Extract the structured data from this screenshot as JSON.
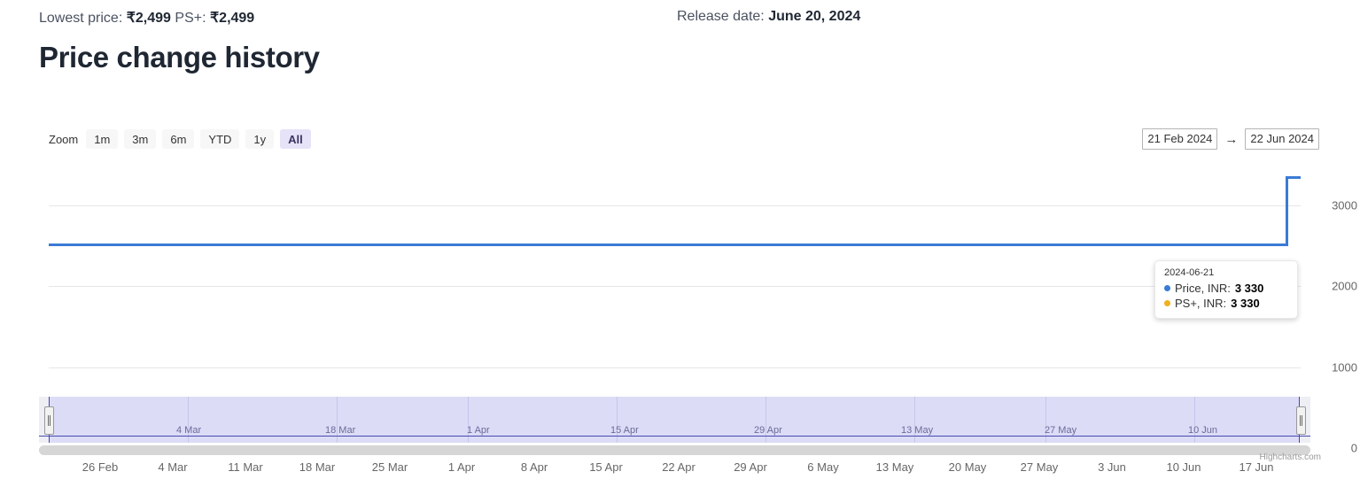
{
  "meta": {
    "lowest_price_label": "Lowest price:",
    "lowest_price_value": "₹2,499",
    "psplus_label": "PS+:",
    "psplus_value": "₹2,499",
    "release_label": "Release date:",
    "release_value": "June 20, 2024"
  },
  "page_title": "Price change history",
  "range_selector": {
    "zoom_label": "Zoom",
    "buttons": [
      {
        "label": "1m",
        "selected": false
      },
      {
        "label": "3m",
        "selected": false
      },
      {
        "label": "6m",
        "selected": false
      },
      {
        "label": "YTD",
        "selected": false
      },
      {
        "label": "1y",
        "selected": false
      },
      {
        "label": "All",
        "selected": true
      }
    ],
    "from_value": "21 Feb 2024",
    "separator": "→",
    "to_value": "22 Jun 2024"
  },
  "tooltip": {
    "date": "2024-06-21",
    "rows": [
      {
        "name": "Price, INR:",
        "value": "3 330",
        "color": "#3a7bd5"
      },
      {
        "name": "PS+, INR:",
        "value": "3 330",
        "color": "#f2b01e"
      }
    ]
  },
  "credits": "Highcharts.com",
  "colors": {
    "price_series": "#3a7bd5",
    "psplus_series": "#f2b01e",
    "selected_range_button": "#e6e2f8",
    "navigator_mask": "#dcdcf7",
    "navigator_outline": "#4444bb"
  },
  "navigator": {
    "tick_labels": [
      "4 Mar",
      "18 Mar",
      "1 Apr",
      "15 Apr",
      "29 Apr",
      "13 May",
      "27 May",
      "10 Jun"
    ],
    "selection_start_pct": 0.8,
    "selection_end_pct": 99.3
  },
  "chart_data": {
    "type": "line",
    "title": "Price change history",
    "xlabel": "",
    "ylabel": "",
    "ylim": [
      0,
      3500
    ],
    "grid": true,
    "legend_position": "none",
    "y_ticks": [
      "3000",
      "2000",
      "1000",
      "0"
    ],
    "y_tick_values": [
      3000,
      2000,
      1000,
      0
    ],
    "x_tick_labels": [
      "26 Feb",
      "4 Mar",
      "11 Mar",
      "18 Mar",
      "25 Mar",
      "1 Apr",
      "8 Apr",
      "15 Apr",
      "22 Apr",
      "29 Apr",
      "6 May",
      "13 May",
      "20 May",
      "27 May",
      "3 Jun",
      "10 Jun",
      "17 Jun"
    ],
    "x_range": [
      "2024-02-21",
      "2024-06-22"
    ],
    "series": [
      {
        "name": "Price, INR",
        "color": "#3a7bd5",
        "step": true,
        "points": [
          {
            "x": "2024-02-21",
            "y": 2499
          },
          {
            "x": "2024-06-20",
            "y": 2499
          },
          {
            "x": "2024-06-21",
            "y": 3330
          },
          {
            "x": "2024-06-22",
            "y": 3330
          }
        ]
      },
      {
        "name": "PS+, INR",
        "color": "#f2b01e",
        "step": true,
        "points": [
          {
            "x": "2024-02-21",
            "y": 2499
          },
          {
            "x": "2024-06-20",
            "y": 2499
          },
          {
            "x": "2024-06-21",
            "y": 3330
          },
          {
            "x": "2024-06-22",
            "y": 3330
          }
        ]
      }
    ]
  }
}
